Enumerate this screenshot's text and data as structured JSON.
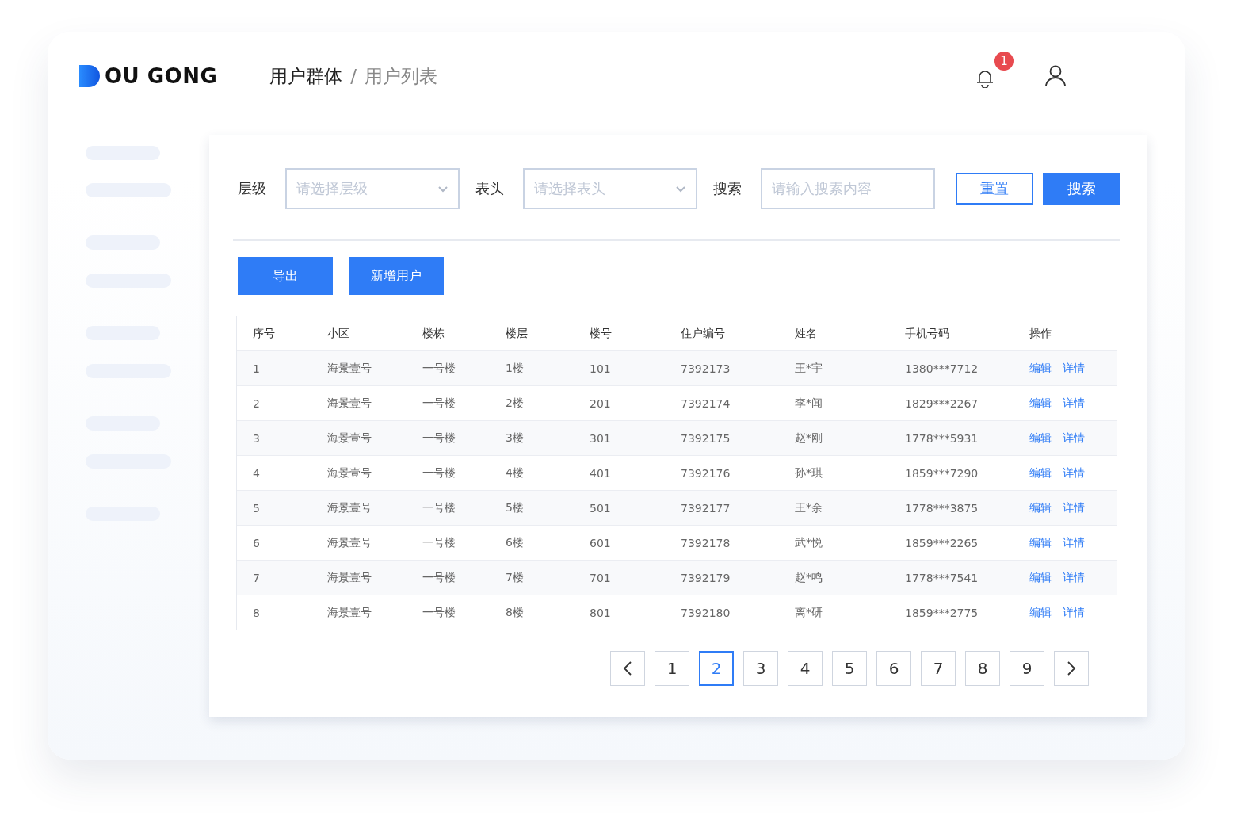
{
  "header": {
    "logo": "OU GONG",
    "breadcrumb": [
      {
        "label": "用户群体",
        "current": false
      },
      {
        "label": "用户列表",
        "current": true
      }
    ],
    "separator": "/",
    "notification_count": "1"
  },
  "filters": [
    {
      "kind": "select",
      "label": "层级",
      "placeholder": "请选择层级"
    },
    {
      "kind": "select",
      "label": "表头",
      "placeholder": "请选择表头"
    },
    {
      "kind": "input",
      "label": "搜索",
      "placeholder": "请输入搜索内容"
    }
  ],
  "filter_buttons": [
    {
      "label": "重置",
      "kind": "outline"
    },
    {
      "label": "搜索",
      "kind": "primary"
    }
  ],
  "actions": [
    "导出",
    "新增用户"
  ],
  "table": {
    "columns": [
      "序号",
      "小区",
      "楼栋",
      "楼层",
      "楼号",
      "住户编号",
      "姓名",
      "手机号码",
      "操作"
    ],
    "rows": [
      {
        "cells": [
          "1",
          "海景壹号",
          "一号楼",
          "1楼",
          "101",
          "7392173",
          "王*宇",
          "1380***7712"
        ],
        "actions": [
          "编辑",
          "详情"
        ]
      },
      {
        "cells": [
          "2",
          "海景壹号",
          "一号楼",
          "2楼",
          "201",
          "7392174",
          "李*闻",
          "1829***2267"
        ],
        "actions": [
          "编辑",
          "详情"
        ]
      },
      {
        "cells": [
          "3",
          "海景壹号",
          "一号楼",
          "3楼",
          "301",
          "7392175",
          "赵*刚",
          "1778***5931"
        ],
        "actions": [
          "编辑",
          "详情"
        ]
      },
      {
        "cells": [
          "4",
          "海景壹号",
          "一号楼",
          "4楼",
          "401",
          "7392176",
          "孙*琪",
          "1859***7290"
        ],
        "actions": [
          "编辑",
          "详情"
        ]
      },
      {
        "cells": [
          "5",
          "海景壹号",
          "一号楼",
          "5楼",
          "501",
          "7392177",
          "王*余",
          "1778***3875"
        ],
        "actions": [
          "编辑",
          "详情"
        ]
      },
      {
        "cells": [
          "6",
          "海景壹号",
          "一号楼",
          "6楼",
          "601",
          "7392178",
          "武*悦",
          "1859***2265"
        ],
        "actions": [
          "编辑",
          "详情"
        ]
      },
      {
        "cells": [
          "7",
          "海景壹号",
          "一号楼",
          "7楼",
          "701",
          "7392179",
          "赵*鸣",
          "1778***7541"
        ],
        "actions": [
          "编辑",
          "详情"
        ]
      },
      {
        "cells": [
          "8",
          "海景壹号",
          "一号楼",
          "8楼",
          "801",
          "7392180",
          "离*研",
          "1859***2775"
        ],
        "actions": [
          "编辑",
          "详情"
        ]
      }
    ]
  },
  "pagination": [
    {
      "label": "1",
      "selected": false
    },
    {
      "label": "2",
      "selected": true
    },
    {
      "label": "3",
      "selected": false
    },
    {
      "label": "4",
      "selected": false
    },
    {
      "label": "5",
      "selected": false
    },
    {
      "label": "6",
      "selected": false
    },
    {
      "label": "7",
      "selected": false
    },
    {
      "label": "8",
      "selected": false
    },
    {
      "label": "9",
      "selected": false
    }
  ]
}
